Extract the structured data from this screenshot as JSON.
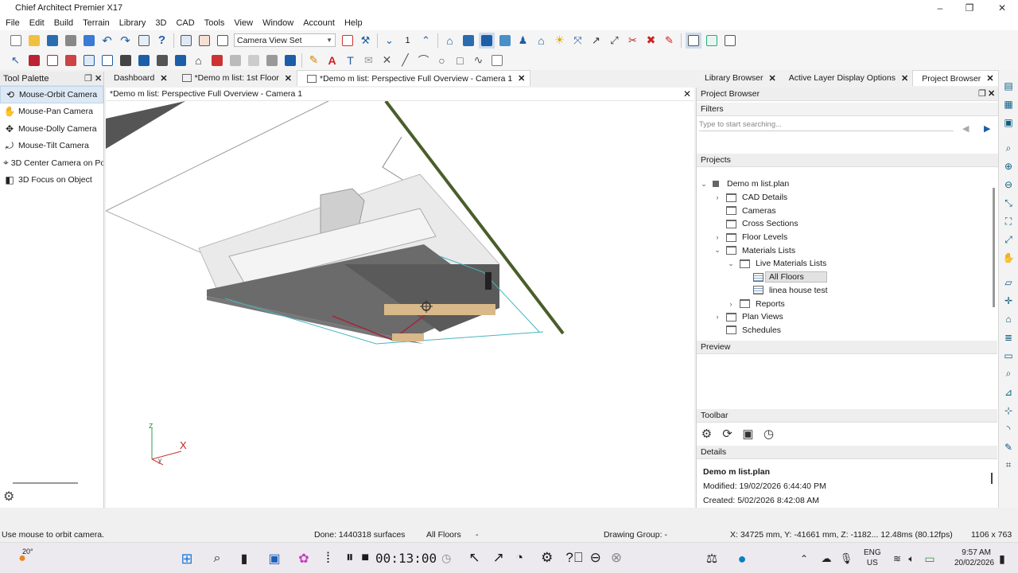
{
  "window": {
    "title": "Chief Architect Premier X17",
    "min": "–",
    "max": "❐",
    "close": "✕"
  },
  "menu": [
    "File",
    "Edit",
    "Build",
    "Terrain",
    "Library",
    "3D",
    "CAD",
    "Tools",
    "View",
    "Window",
    "Account",
    "Help"
  ],
  "toolbar": {
    "camera_view_set": "Camera View Set",
    "layer_number": "1"
  },
  "tool_palette": {
    "title": "Tool Palette",
    "items": [
      {
        "label": "Mouse-Orbit Camera",
        "icon": "orbit-icon"
      },
      {
        "label": "Mouse-Pan Camera",
        "icon": "hand-icon"
      },
      {
        "label": "Mouse-Dolly Camera",
        "icon": "dolly-icon"
      },
      {
        "label": "Mouse-Tilt Camera",
        "icon": "tilt-icon"
      },
      {
        "label": "3D Center Camera on Po",
        "icon": "center-camera-icon"
      },
      {
        "label": "3D Focus on Object",
        "icon": "focus-icon"
      }
    ]
  },
  "doc_tabs": [
    {
      "label": "Dashboard",
      "close": "✕"
    },
    {
      "label": "*Demo m list: 1st Floor",
      "close": "✕"
    },
    {
      "label": "*Demo m list: Perspective Full Overview - Camera 1",
      "close": "✕"
    }
  ],
  "viewport": {
    "title": "*Demo m list: Perspective Full Overview - Camera 1",
    "axis_z": "z",
    "axis_x": "X",
    "axis_y": "y"
  },
  "right_tabs": [
    {
      "label": "Library Browser",
      "close": "✕"
    },
    {
      "label": "Active Layer Display Options",
      "close": "✕"
    },
    {
      "label": "Project Browser",
      "close": "✕"
    }
  ],
  "project_browser": {
    "title": "Project Browser",
    "filters_label": "Filters",
    "search_placeholder": "Type to start searching...",
    "projects_label": "Projects",
    "tree": [
      {
        "label": "Demo m list.plan",
        "level": 0,
        "exp": "⌄",
        "type": "plan"
      },
      {
        "label": "CAD Details",
        "level": 1,
        "exp": "›",
        "type": "folder"
      },
      {
        "label": "Cameras",
        "level": 1,
        "exp": "",
        "type": "folder"
      },
      {
        "label": "Cross Sections",
        "level": 1,
        "exp": "",
        "type": "folder"
      },
      {
        "label": "Floor Levels",
        "level": 1,
        "exp": "›",
        "type": "folder"
      },
      {
        "label": "Materials Lists",
        "level": 1,
        "exp": "⌄",
        "type": "folder"
      },
      {
        "label": "Live Materials Lists",
        "level": 2,
        "exp": "⌄",
        "type": "folder"
      },
      {
        "label": "All Floors",
        "level": 3,
        "exp": "",
        "type": "doc",
        "selected": true
      },
      {
        "label": "linea house test",
        "level": 3,
        "exp": "",
        "type": "doc"
      },
      {
        "label": "Reports",
        "level": 2,
        "exp": "›",
        "type": "folder"
      },
      {
        "label": "Plan Views",
        "level": 1,
        "exp": "›",
        "type": "folder"
      },
      {
        "label": "Schedules",
        "level": 1,
        "exp": "",
        "type": "folder"
      }
    ],
    "preview_label": "Preview",
    "toolbar_label": "Toolbar",
    "details_label": "Details",
    "details": {
      "name": "Demo m list.plan",
      "modified": "Modified:  19/02/2026 6:44:40 PM",
      "created": "Created:   5/02/2026 8:42:08 AM"
    }
  },
  "status": {
    "hint": "Use mouse to orbit camera.",
    "done": "Done:  1440318 surfaces",
    "floors": "All Floors",
    "dash": "-",
    "drawing_group": "Drawing Group: -",
    "coords": "X: 34725 mm, Y: -41661 mm, Z: -1182...  12.48ms (80.12fps)",
    "size": "1106 x 763"
  },
  "taskbar": {
    "weather": "20°",
    "timer": "00:13:00",
    "lang1": "ENG",
    "lang2": "US",
    "time": "9:57 AM",
    "date": "20/02/2026"
  }
}
